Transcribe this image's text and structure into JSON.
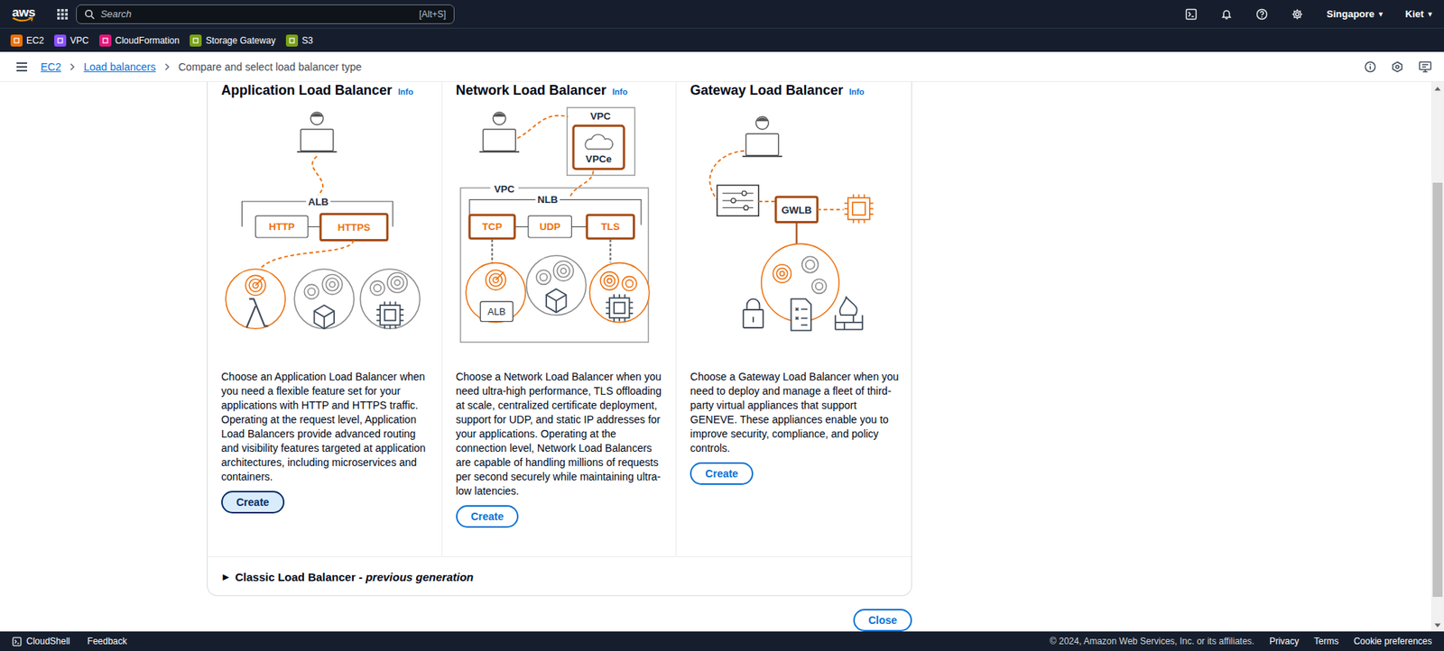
{
  "nav": {
    "logo": "aws",
    "search": {
      "placeholder": "Search",
      "shortcut": "[Alt+S]"
    },
    "region": "Singapore",
    "region_caret": "▼",
    "user": "Kiet",
    "user_caret": "▼"
  },
  "favorites": [
    {
      "label": "EC2",
      "color": "#ed7100"
    },
    {
      "label": "VPC",
      "color": "#8c4fff"
    },
    {
      "label": "CloudFormation",
      "color": "#e7157b"
    },
    {
      "label": "Storage Gateway",
      "color": "#7aa116"
    },
    {
      "label": "S3",
      "color": "#7aa116"
    }
  ],
  "breadcrumbs": [
    {
      "label": "EC2",
      "link": true
    },
    {
      "label": "Load balancers",
      "link": true
    },
    {
      "label": "Compare and select load balancer type",
      "link": false
    }
  ],
  "load_balancers": [
    {
      "name": "Application Load Balancer",
      "info": "Info",
      "kind": "alb",
      "diagram": {
        "group": "ALB",
        "protocols": [
          {
            "label": "HTTP",
            "highlighted": false
          },
          {
            "label": "HTTPS",
            "highlighted": true
          }
        ],
        "targets": [
          {
            "highlighted": true
          },
          {
            "highlighted": false
          },
          {
            "highlighted": false
          }
        ]
      },
      "description": "Choose an Application Load Balancer when you need a flexible feature set for your applications with HTTP and HTTPS traffic. Operating at the request level, Application Load Balancers provide advanced routing and visibility features targeted at application architectures, including microservices and containers.",
      "button": {
        "label": "Create",
        "hovered": true
      }
    },
    {
      "name": "Network Load Balancer",
      "info": "Info",
      "kind": "nlb",
      "diagram": {
        "outer": "VPC",
        "endpoint_vpc": "VPC",
        "endpoint": "VPCe",
        "group": "NLB",
        "protocols": [
          {
            "label": "TCP",
            "highlighted": true
          },
          {
            "label": "UDP",
            "highlighted": false
          },
          {
            "label": "TLS",
            "highlighted": true
          }
        ],
        "targets": [
          {
            "highlighted": true
          },
          {
            "highlighted": false
          },
          {
            "highlighted": true
          }
        ],
        "target_label": "ALB"
      },
      "description": "Choose a Network Load Balancer when you need ultra-high performance, TLS offloading at scale, centralized certificate deployment, support for UDP, and static IP addresses for your applications. Operating at the connection level, Network Load Balancers are capable of handling millions of requests per second securely while maintaining ultra-low latencies.",
      "button": {
        "label": "Create",
        "hovered": false
      }
    },
    {
      "name": "Gateway Load Balancer",
      "info": "Info",
      "kind": "gwlb",
      "diagram": {
        "group": "GWLB"
      },
      "description": "Choose a Gateway Load Balancer when you need to deploy and manage a fleet of third-party virtual appliances that support GENEVE. These appliances enable you to improve security, compliance, and policy controls.",
      "button": {
        "label": "Create",
        "hovered": false
      }
    }
  ],
  "classic": {
    "caret": "▶",
    "title": "Classic Load Balancer -",
    "suffix": "previous generation",
    "expanded": false
  },
  "close_button": "Close",
  "scrollbar": {
    "thumb_share": 0.79,
    "position": 0.8
  },
  "footer": {
    "left": [
      "CloudShell",
      "Feedback"
    ],
    "copyright": "© 2024, Amazon Web Services, Inc. or its affiliates.",
    "links": [
      "Privacy",
      "Terms",
      "Cookie preferences"
    ]
  }
}
